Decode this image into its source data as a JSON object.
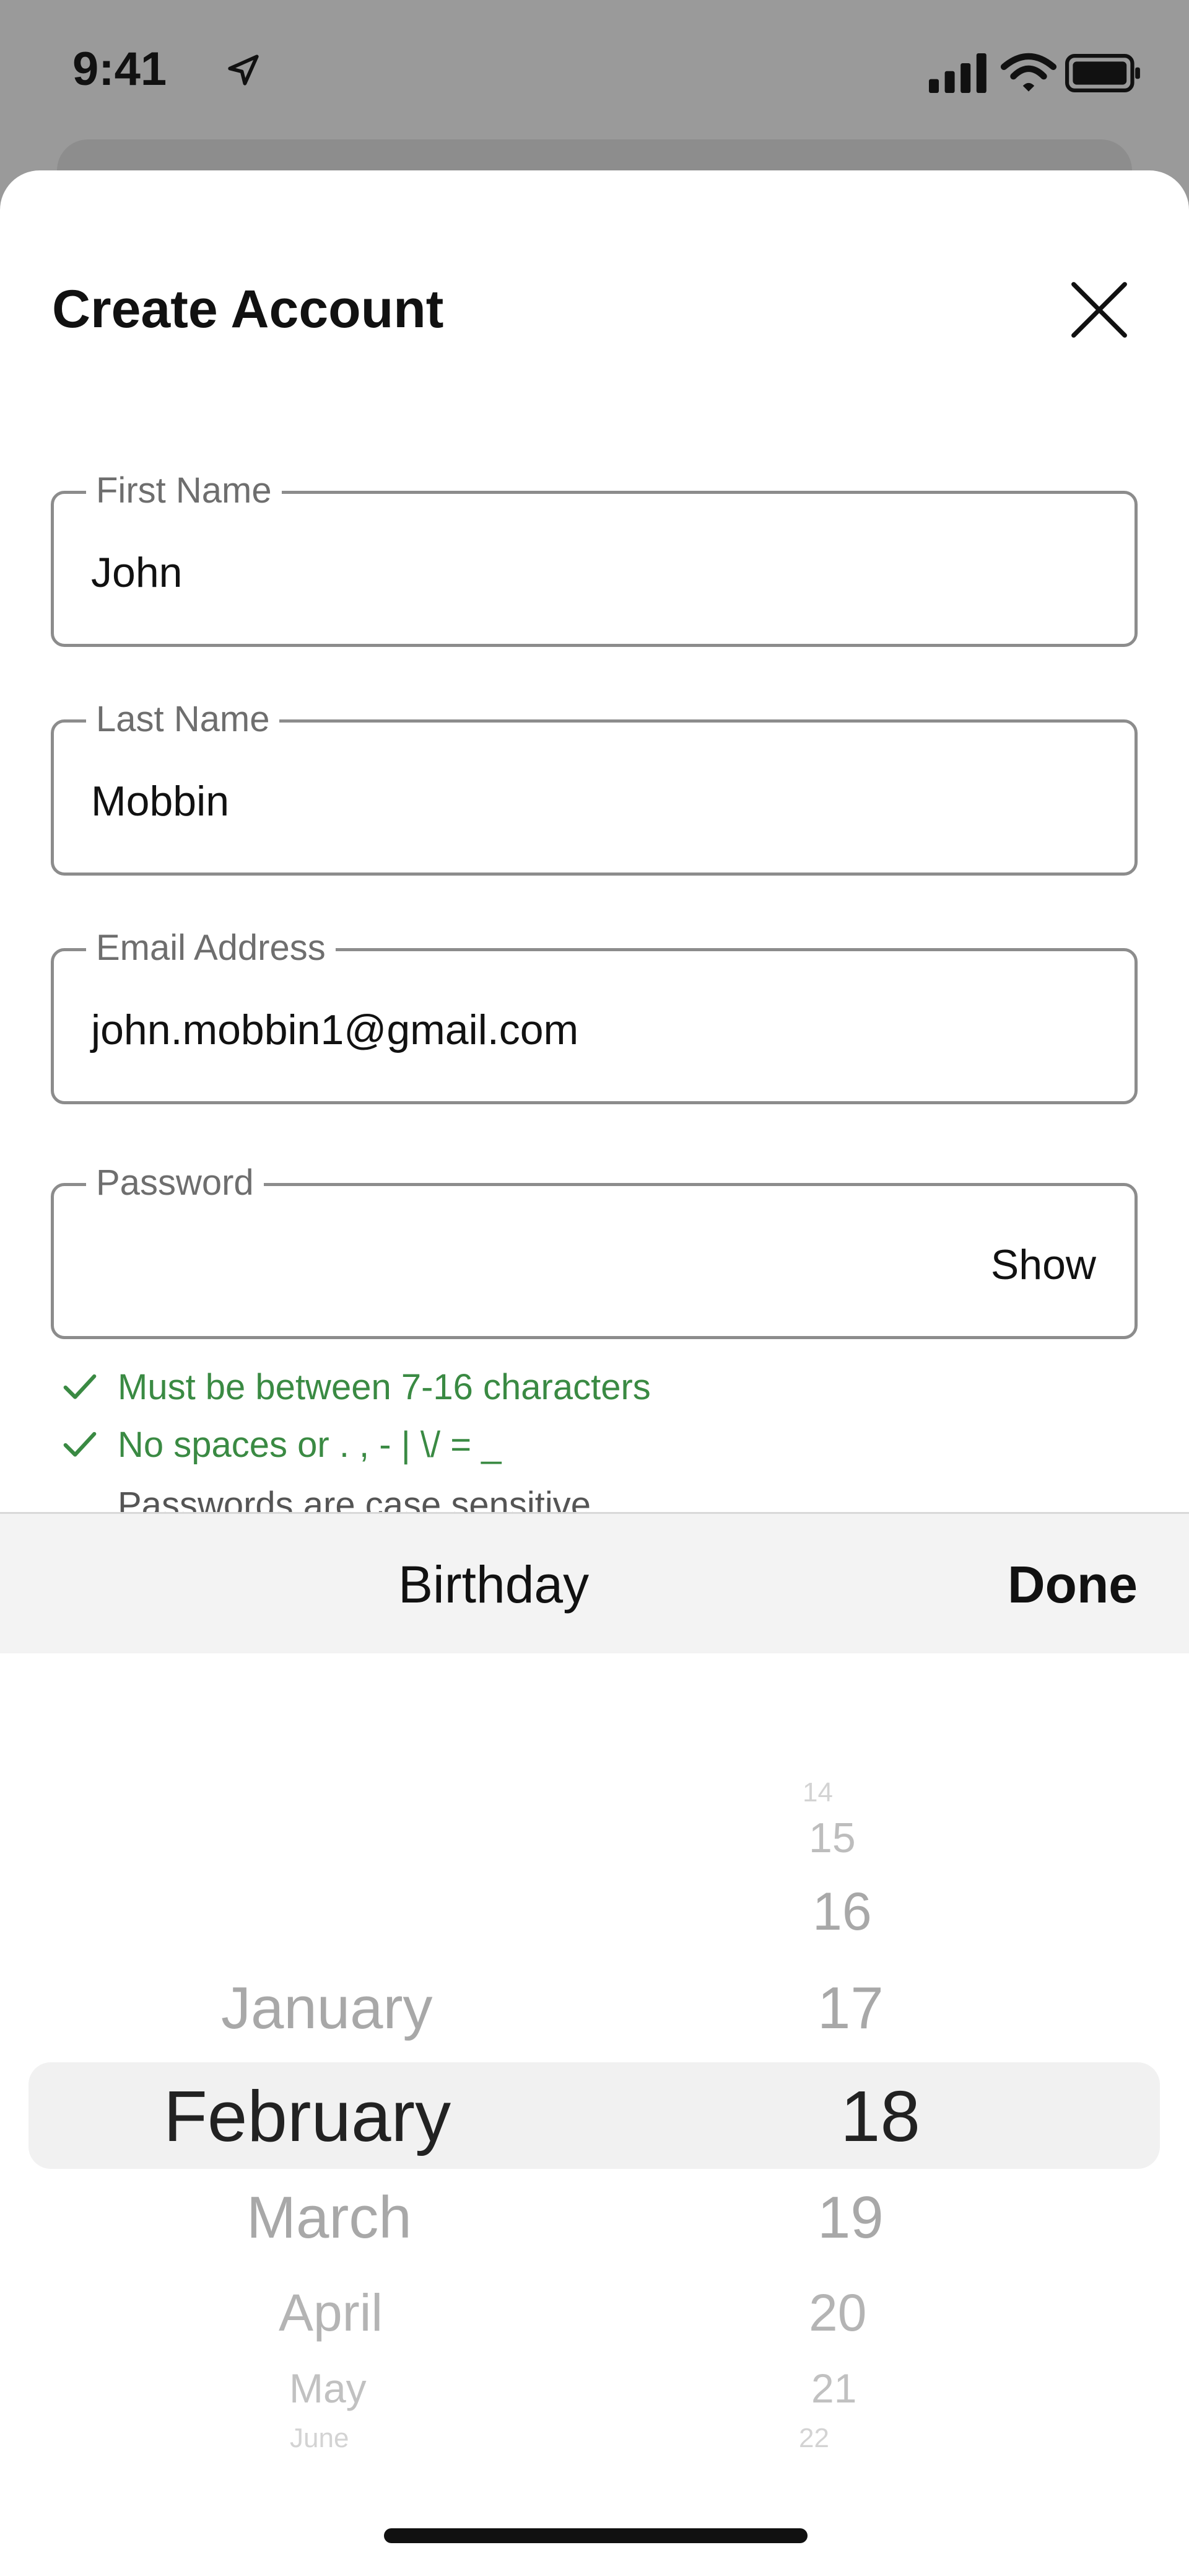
{
  "status_bar": {
    "time": "9:41"
  },
  "sheet": {
    "title": "Create Account",
    "fields": [
      {
        "label": "First Name",
        "value": "John"
      },
      {
        "label": "Last Name",
        "value": "Mobbin"
      },
      {
        "label": "Email Address",
        "value": "john.mobbin1@gmail.com"
      },
      {
        "label": "Password",
        "value": "",
        "show_label": "Show"
      }
    ],
    "password_rules": [
      "Must be between 7-16 characters",
      "No spaces or . , - | \\/ = _",
      "Passwords are case sensitive"
    ]
  },
  "picker_toolbar": {
    "title": "Birthday",
    "done_label": "Done"
  },
  "picker": {
    "months": [
      "January",
      "February",
      "March",
      "April",
      "May",
      "June"
    ],
    "days": [
      "14",
      "15",
      "16",
      "17",
      "18",
      "19",
      "20",
      "21",
      "22"
    ],
    "selected_month": "February",
    "selected_day": "18"
  },
  "colors": {
    "success_green": "#3a8a43",
    "backdrop_gray": "#9a9a9a",
    "picker_highlight": "#f1f1f1"
  },
  "icons": [
    "location-icon",
    "signal-icon",
    "wifi-icon",
    "battery-icon",
    "close-icon",
    "check-icon"
  ]
}
